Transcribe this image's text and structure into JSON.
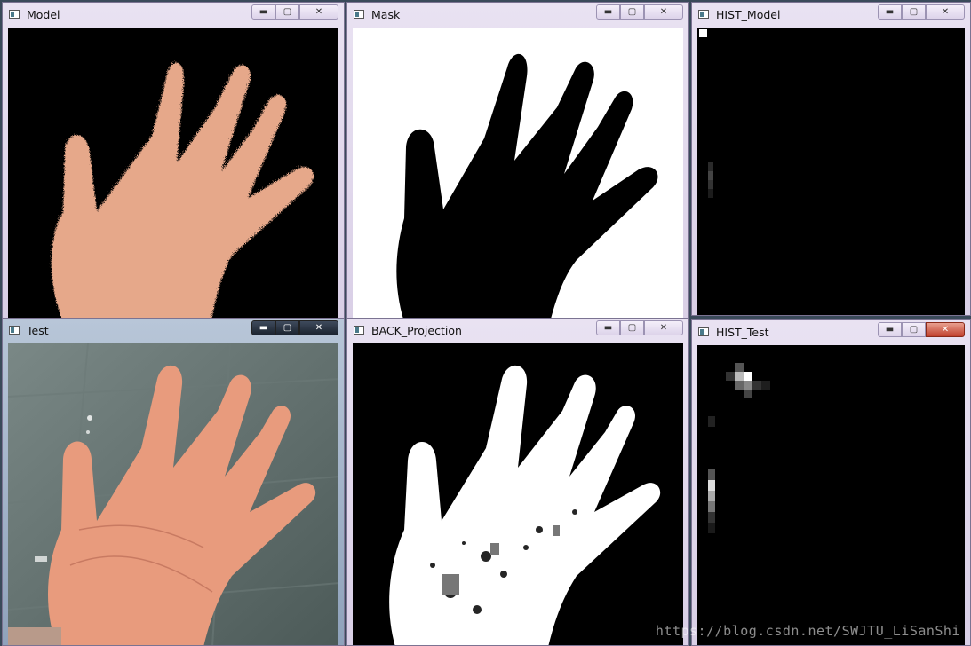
{
  "windows": {
    "model": {
      "title": "Model"
    },
    "mask": {
      "title": "Mask"
    },
    "hist_model": {
      "title": "HIST_Model"
    },
    "test": {
      "title": "Test"
    },
    "back_projection": {
      "title": "BACK_Projection"
    },
    "hist_test": {
      "title": "HIST_Test"
    }
  },
  "controls": {
    "minimize": "▬",
    "maximize": "▢",
    "close": "✕"
  },
  "watermark": "https://blog.csdn.net/SWJTU_LiSanShi",
  "colors": {
    "skin": "#e8a886",
    "titlebar": "#e3dcee",
    "active_titlebar": "#9aabc2"
  }
}
